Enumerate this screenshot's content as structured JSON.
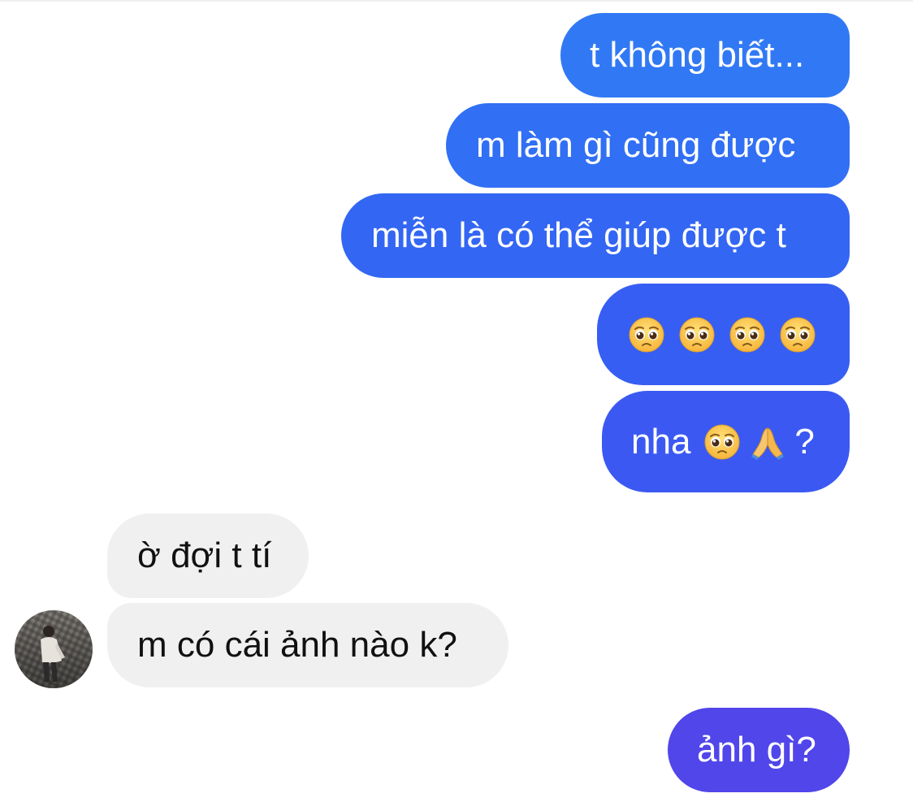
{
  "conversation": {
    "messages": [
      {
        "sender": "me",
        "text": "t không biết..."
      },
      {
        "sender": "me",
        "text": "m làm gì cũng được"
      },
      {
        "sender": "me",
        "text": "miễn là có thể giúp được t"
      },
      {
        "sender": "me",
        "emoji": [
          "pleading-face",
          "pleading-face",
          "pleading-face",
          "pleading-face"
        ]
      },
      {
        "sender": "me",
        "text": "nha",
        "emoji": [
          "pleading-face",
          "folded-hands"
        ],
        "suffix": "?"
      },
      {
        "sender": "other",
        "text": "ờ đợi t tí"
      },
      {
        "sender": "other",
        "text": "m có cái ảnh nào k?"
      },
      {
        "sender": "me",
        "text": "ảnh gì?"
      }
    ]
  },
  "contact": {
    "avatar_icon": "contact-avatar"
  },
  "colors": {
    "outgoing_top": "#3179f4",
    "outgoing_bottom": "#5046ea",
    "incoming": "#f0f0f0",
    "incoming_text": "#111111"
  }
}
